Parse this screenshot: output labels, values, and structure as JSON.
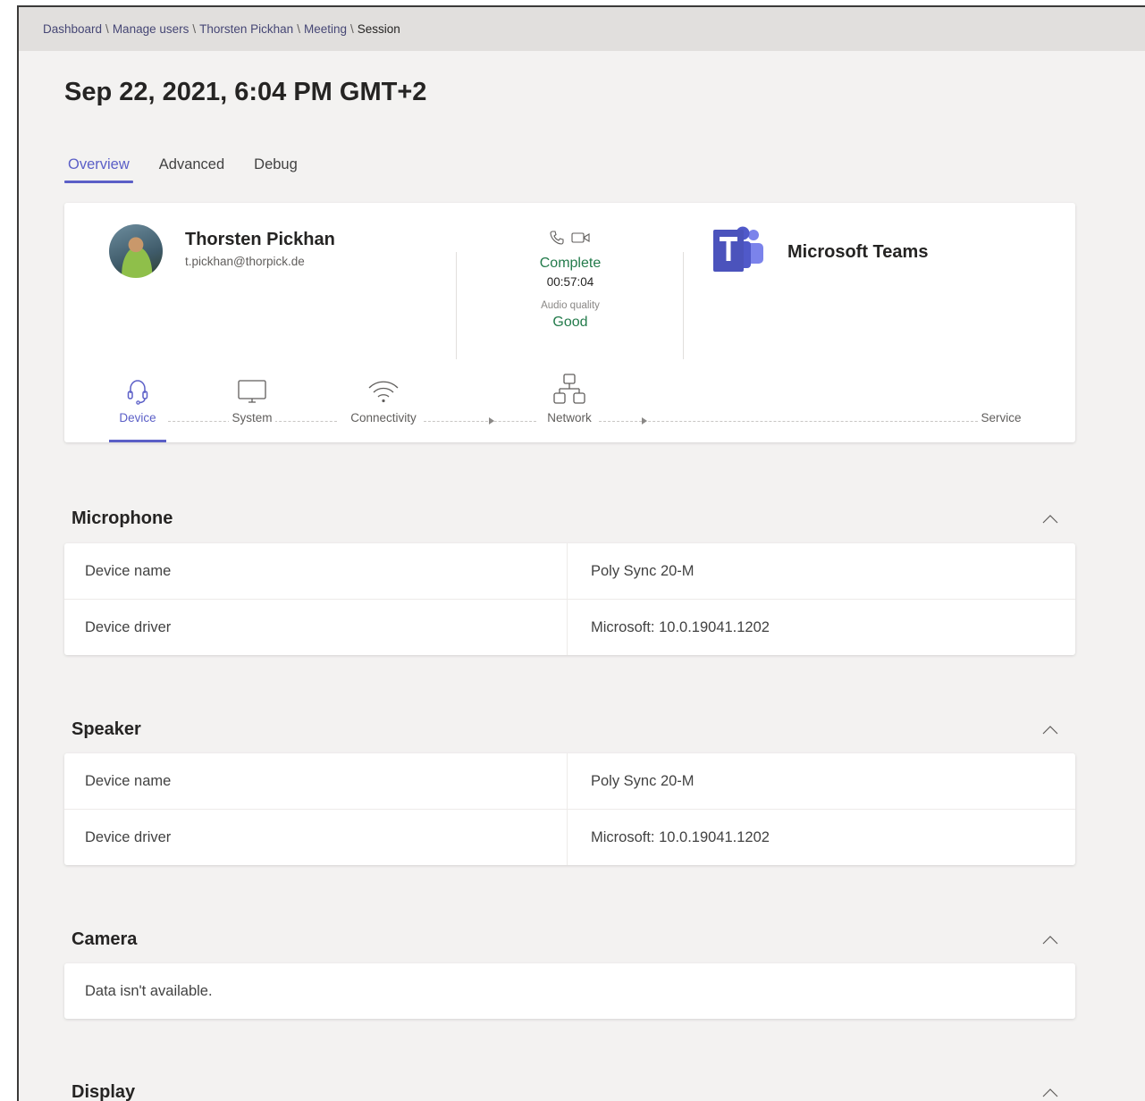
{
  "breadcrumb": [
    "Dashboard",
    "Manage users",
    "Thorsten Pickhan",
    "Meeting",
    "Session"
  ],
  "page_title": "Sep 22, 2021, 6:04 PM GMT+2",
  "tabs": [
    {
      "label": "Overview",
      "active": true
    },
    {
      "label": "Advanced",
      "active": false
    },
    {
      "label": "Debug",
      "active": false
    }
  ],
  "summary": {
    "user_name": "Thorsten Pickhan",
    "user_email": "t.pickhan@thorpick.de",
    "call_status": "Complete",
    "duration": "00:57:04",
    "audio_quality_label": "Audio quality",
    "audio_quality_value": "Good",
    "app_name": "Microsoft Teams",
    "status_color": "#237b4b",
    "accent_color": "#5b5fc7"
  },
  "pipeline": {
    "stages": [
      "Device",
      "System",
      "Connectivity",
      "Network",
      "Service"
    ],
    "active": "Device"
  },
  "sections": {
    "microphone": {
      "title": "Microphone",
      "rows": [
        {
          "label": "Device name",
          "value": "Poly Sync 20-M"
        },
        {
          "label": "Device driver",
          "value": "Microsoft: 10.0.19041.1202"
        }
      ]
    },
    "speaker": {
      "title": "Speaker",
      "rows": [
        {
          "label": "Device name",
          "value": "Poly Sync 20-M"
        },
        {
          "label": "Device driver",
          "value": "Microsoft: 10.0.19041.1202"
        }
      ]
    },
    "camera": {
      "title": "Camera",
      "message": "Data isn't available."
    },
    "display": {
      "title": "Display"
    }
  },
  "icons": {
    "call": "phone-icon",
    "video": "video-camera-icon",
    "device": "headset-icon",
    "system": "monitor-icon",
    "connectivity": "wifi-icon",
    "network": "network-icon",
    "collapse": "chevron-up-icon"
  }
}
